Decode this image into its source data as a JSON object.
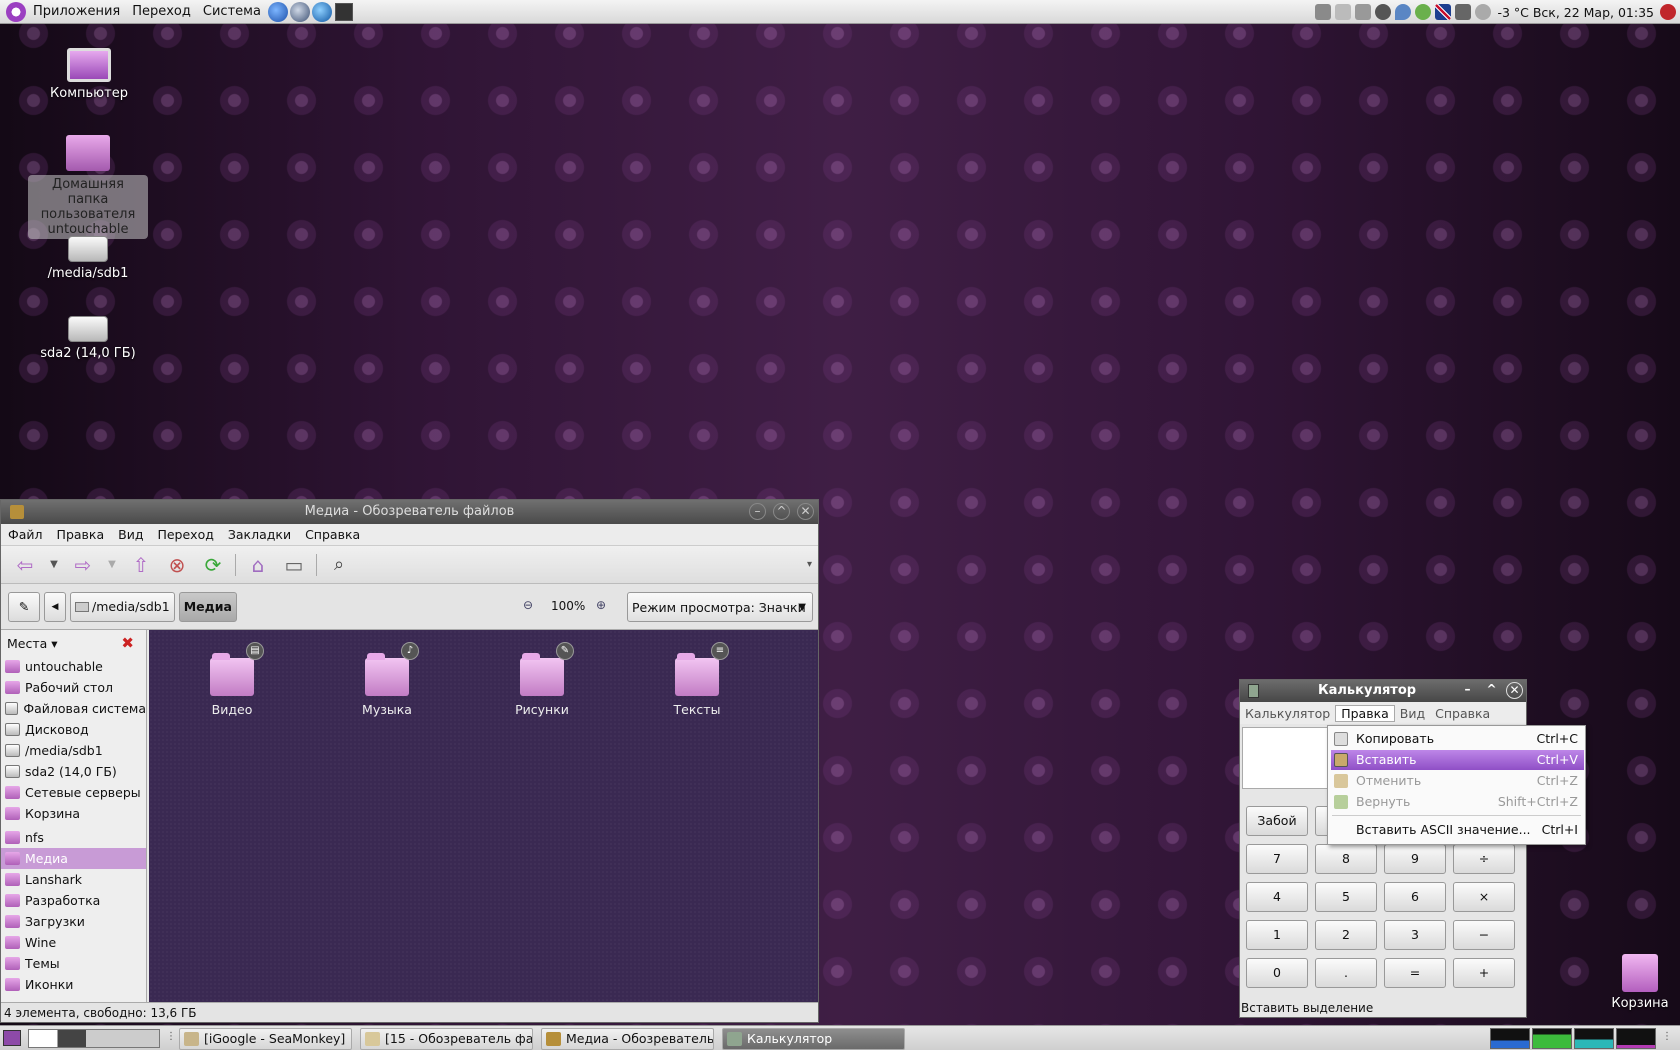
{
  "top_panel": {
    "menus": [
      "Приложения",
      "Переход",
      "Система"
    ],
    "clock": "-3 °C Вск, 22 Мар, 01:35"
  },
  "desktop": {
    "icons": [
      {
        "label": "Компьютер"
      },
      {
        "label": "Домашняя папка пользователя untouchable"
      },
      {
        "label": "/media/sdb1"
      },
      {
        "label": "sda2 (14,0 ГБ)"
      }
    ],
    "trash_label": "Корзина"
  },
  "file_manager": {
    "title": "Медиа - Обозреватель файлов",
    "menu": [
      "Файл",
      "Правка",
      "Вид",
      "Переход",
      "Закладки",
      "Справка"
    ],
    "path_buttons": [
      "/media/sdb1",
      "Медиа"
    ],
    "zoom": "100%",
    "view_mode": "Режим просмотра: Значки",
    "sidebar_title": "Места",
    "places": [
      "untouchable",
      "Рабочий стол",
      "Файловая система",
      "Дисковод",
      "/media/sdb1",
      "sda2 (14,0 ГБ)",
      "Сетевые серверы",
      "Корзина"
    ],
    "bookmarks": [
      "nfs",
      "Медиа",
      "Lanshark",
      "Разработка",
      "Загрузки",
      "Wine",
      "Темы",
      "Иконки"
    ],
    "folders": [
      "Видео",
      "Музыка",
      "Рисунки",
      "Тексты"
    ],
    "status": "4 элемента, свободно: 13,6 ГБ"
  },
  "calculator": {
    "title": "Калькулятор",
    "menu": [
      "Калькулятор",
      "Правка",
      "Вид",
      "Справка"
    ],
    "buttons": {
      "backspace": "Забой",
      "row1": [
        "7",
        "8",
        "9",
        "÷"
      ],
      "row2": [
        "4",
        "5",
        "6",
        "×"
      ],
      "row3": [
        "1",
        "2",
        "3",
        "−"
      ],
      "row4": [
        "0",
        ".",
        "=",
        "+"
      ]
    },
    "status": "Вставить выделение"
  },
  "edit_menu": {
    "items": [
      {
        "label": "Копировать",
        "shortcut": "Ctrl+C"
      },
      {
        "label": "Вставить",
        "shortcut": "Ctrl+V"
      },
      {
        "label": "Отменить",
        "shortcut": "Ctrl+Z"
      },
      {
        "label": "Вернуть",
        "shortcut": "Shift+Ctrl+Z"
      },
      {
        "label": "Вставить ASCII значение...",
        "shortcut": "Ctrl+I"
      }
    ]
  },
  "taskbar": {
    "tasks": [
      "[iGoogle - SeaMonkey]",
      "[15 - Обозреватель фа...",
      "Медиа - Обозреватель...",
      "Калькулятор"
    ]
  },
  "colors": {
    "accent": "#a56fd0",
    "selection": "#c89bd6",
    "folder": "#d690d8"
  }
}
